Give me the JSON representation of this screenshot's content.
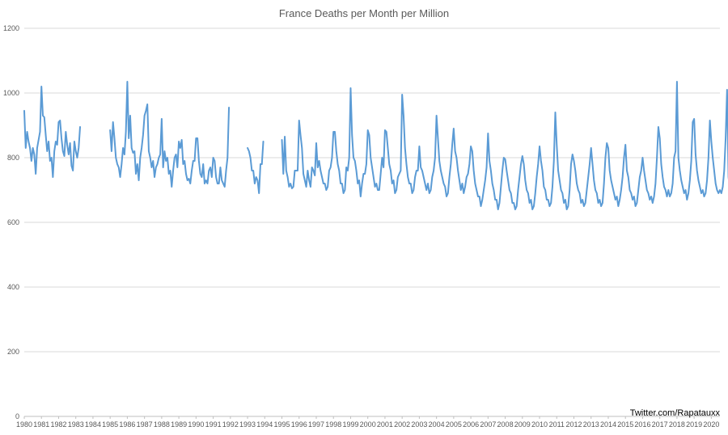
{
  "chart_data": {
    "type": "line",
    "title": "France Deaths per Month per Million",
    "xlabel": "",
    "ylabel": "",
    "ylim": [
      0,
      1200
    ],
    "yticks": [
      0,
      200,
      400,
      600,
      800,
      1000,
      1200
    ],
    "xlim": [
      1980,
      2020.5
    ],
    "xticks": [
      1980,
      1981,
      1982,
      1983,
      1984,
      1985,
      1986,
      1987,
      1988,
      1989,
      1990,
      1991,
      1992,
      1993,
      1994,
      1995,
      1996,
      1997,
      1998,
      1999,
      2000,
      2001,
      2002,
      2003,
      2004,
      2005,
      2006,
      2007,
      2008,
      2009,
      2010,
      2011,
      2012,
      2013,
      2014,
      2015,
      2016,
      2017,
      2018,
      2019,
      2020
    ],
    "grid": true,
    "legend": "none",
    "annotation": "Twitter.com/Rapatauxx",
    "series": [
      {
        "color": "#5b9bd5",
        "start_year": 1980,
        "values": [
          945,
          830,
          880,
          850,
          830,
          790,
          830,
          810,
          750,
          830,
          855,
          880,
          1020,
          930,
          925,
          870,
          820,
          850,
          790,
          800,
          740,
          820,
          850,
          840,
          910,
          915,
          860,
          820,
          805,
          880,
          840,
          810,
          845,
          775,
          760,
          850,
          820,
          800,
          830,
          895,
          null,
          null,
          null,
          null,
          null,
          null,
          null,
          null,
          null,
          null,
          null,
          null,
          null,
          null,
          null,
          null,
          null,
          null,
          null,
          null,
          885,
          820,
          910,
          860,
          800,
          780,
          770,
          740,
          780,
          830,
          810,
          880,
          1035,
          860,
          930,
          830,
          815,
          820,
          750,
          780,
          730,
          800,
          830,
          870,
          930,
          945,
          965,
          820,
          800,
          770,
          790,
          740,
          770,
          780,
          800,
          810,
          920,
          770,
          820,
          790,
          800,
          750,
          760,
          710,
          760,
          800,
          810,
          770,
          850,
          830,
          855,
          780,
          790,
          750,
          730,
          735,
          720,
          760,
          790,
          790,
          860,
          860,
          790,
          750,
          740,
          780,
          720,
          730,
          720,
          760,
          770,
          740,
          800,
          790,
          740,
          720,
          720,
          770,
          730,
          720,
          710,
          760,
          800,
          955,
          null,
          null,
          null,
          null,
          null,
          null,
          null,
          null,
          null,
          null,
          null,
          null,
          830,
          820,
          800,
          760,
          760,
          720,
          740,
          730,
          690,
          780,
          780,
          850,
          null,
          null,
          null,
          null,
          null,
          null,
          null,
          null,
          null,
          null,
          null,
          null,
          855,
          750,
          865,
          760,
          740,
          710,
          720,
          705,
          710,
          760,
          760,
          760,
          915,
          870,
          830,
          750,
          730,
          710,
          760,
          730,
          710,
          770,
          760,
          745,
          845,
          770,
          790,
          760,
          740,
          720,
          720,
          700,
          710,
          760,
          770,
          800,
          880,
          880,
          820,
          780,
          760,
          720,
          720,
          690,
          700,
          770,
          760,
          800,
          1015,
          870,
          800,
          790,
          760,
          720,
          730,
          680,
          720,
          750,
          750,
          780,
          885,
          870,
          800,
          770,
          740,
          710,
          720,
          700,
          700,
          750,
          800,
          770,
          885,
          880,
          830,
          780,
          760,
          720,
          730,
          690,
          700,
          740,
          750,
          760,
          995,
          930,
          830,
          780,
          740,
          720,
          720,
          690,
          700,
          740,
          760,
          760,
          835,
          770,
          760,
          740,
          720,
          700,
          720,
          690,
          700,
          740,
          760,
          800,
          930,
          860,
          790,
          760,
          740,
          720,
          710,
          680,
          690,
          740,
          780,
          840,
          890,
          820,
          800,
          760,
          730,
          700,
          720,
          690,
          710,
          740,
          750,
          780,
          835,
          820,
          760,
          720,
          700,
          680,
          680,
          650,
          670,
          700,
          730,
          770,
          875,
          790,
          760,
          720,
          700,
          670,
          670,
          640,
          660,
          710,
          760,
          800,
          795,
          760,
          730,
          700,
          690,
          660,
          660,
          640,
          650,
          700,
          740,
          780,
          805,
          780,
          730,
          700,
          690,
          660,
          670,
          640,
          650,
          690,
          740,
          780,
          835,
          790,
          760,
          710,
          700,
          670,
          670,
          650,
          660,
          710,
          790,
          940,
          840,
          760,
          730,
          700,
          690,
          660,
          670,
          640,
          650,
          700,
          780,
          810,
          790,
          760,
          720,
          700,
          690,
          660,
          670,
          650,
          660,
          700,
          740,
          780,
          830,
          780,
          730,
          700,
          690,
          660,
          670,
          650,
          660,
          720,
          800,
          845,
          830,
          760,
          730,
          710,
          690,
          670,
          680,
          650,
          670,
          700,
          740,
          800,
          840,
          760,
          740,
          700,
          690,
          670,
          680,
          650,
          660,
          700,
          740,
          760,
          800,
          760,
          730,
          700,
          690,
          670,
          680,
          660,
          680,
          720,
          800,
          895,
          860,
          780,
          740,
          710,
          700,
          680,
          700,
          680,
          690,
          720,
          800,
          820,
          1035,
          800,
          760,
          730,
          710,
          690,
          700,
          670,
          690,
          730,
          790,
          910,
          920,
          810,
          760,
          730,
          710,
          690,
          700,
          680,
          690,
          730,
          800,
          915,
          850,
          800,
          760,
          720,
          700,
          690,
          700,
          690,
          710,
          760,
          860,
          1010,
          740,
          700,
          700
        ]
      }
    ]
  }
}
